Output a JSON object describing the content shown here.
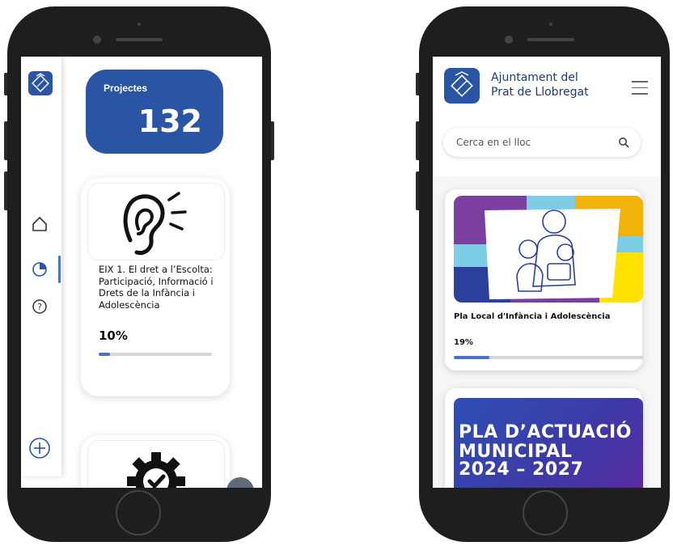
{
  "left_app": {
    "nav": [
      "home-icon",
      "pie-chart-icon",
      "help-icon",
      "add-icon"
    ],
    "stat": {
      "label": "Projectes",
      "value": "132"
    },
    "cards": [
      {
        "icon": "ear-icon",
        "title": "EIX 1. El dret a l’Escolta: Participació, Informació i Drets de la Infància i Adolescència",
        "percent": "10%",
        "progress": 0.1
      },
      {
        "icon": "gear-check-icon"
      }
    ],
    "colors": {
      "primary": "#2a54a4",
      "progress": "#4a72c2"
    }
  },
  "right_app": {
    "brand": {
      "line1": "Ajuntament del",
      "line2": "Prat de Llobregat"
    },
    "search": {
      "placeholder": "Cerca en el lloc"
    },
    "cards": [
      {
        "title": "Pla Local d'Infància i Adolescència",
        "percent": "19%",
        "progress": 0.19
      },
      {
        "banner": {
          "line1": "PLA D’ACTUACIÓ",
          "line2": "MUNICIPAL",
          "line3": "2024 – 2027"
        }
      }
    ]
  }
}
